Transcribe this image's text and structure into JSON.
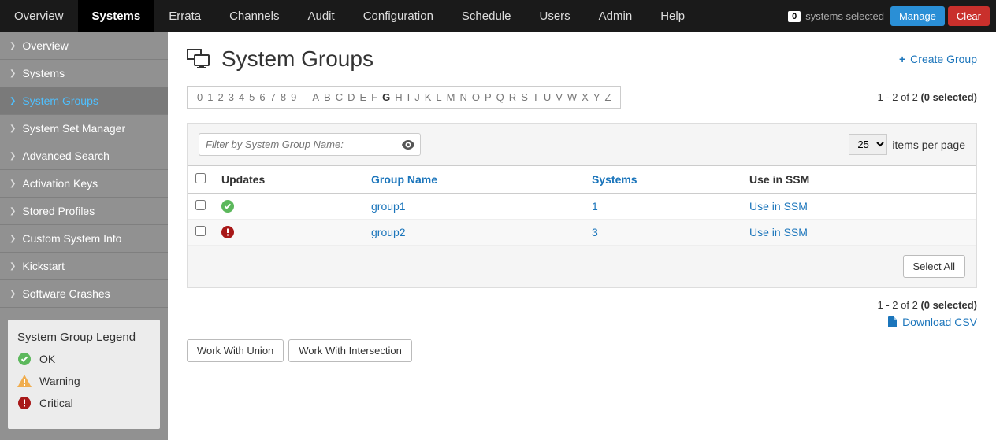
{
  "topnav": {
    "items": [
      "Overview",
      "Systems",
      "Errata",
      "Channels",
      "Audit",
      "Configuration",
      "Schedule",
      "Users",
      "Admin",
      "Help"
    ],
    "active_index": 1,
    "selected_count": "0",
    "selected_label": "systems selected",
    "manage": "Manage",
    "clear": "Clear"
  },
  "sidebar": {
    "items": [
      "Overview",
      "Systems",
      "System Groups",
      "System Set Manager",
      "Advanced Search",
      "Activation Keys",
      "Stored Profiles",
      "Custom System Info",
      "Kickstart",
      "Software Crashes"
    ],
    "active_index": 2
  },
  "legend": {
    "title": "System Group Legend",
    "ok": "OK",
    "warning": "Warning",
    "critical": "Critical"
  },
  "page": {
    "title": "System Groups",
    "create_label": "Create Group"
  },
  "alpha": {
    "digits": [
      "0",
      "1",
      "2",
      "3",
      "4",
      "5",
      "6",
      "7",
      "8",
      "9"
    ],
    "letters": [
      "A",
      "B",
      "C",
      "D",
      "E",
      "F",
      "G",
      "H",
      "I",
      "J",
      "K",
      "L",
      "M",
      "N",
      "O",
      "P",
      "Q",
      "R",
      "S",
      "T",
      "U",
      "V",
      "W",
      "X",
      "Y",
      "Z"
    ],
    "highlight": "G"
  },
  "range": {
    "text": "1 - 2 of 2",
    "selected": "(0 selected)"
  },
  "filter": {
    "placeholder": "Filter by System Group Name:"
  },
  "perpage": {
    "value": "25",
    "label": "items per page"
  },
  "table": {
    "headers": {
      "updates": "Updates",
      "group": "Group Name",
      "systems": "Systems",
      "ssm": "Use in SSM"
    },
    "rows": [
      {
        "status": "ok",
        "name": "group1",
        "systems": "1",
        "ssm": "Use in SSM"
      },
      {
        "status": "critical",
        "name": "group2",
        "systems": "3",
        "ssm": "Use in SSM"
      }
    ]
  },
  "select_all": "Select All",
  "download": "Download CSV",
  "actions": {
    "union": "Work With Union",
    "intersection": "Work With Intersection"
  }
}
